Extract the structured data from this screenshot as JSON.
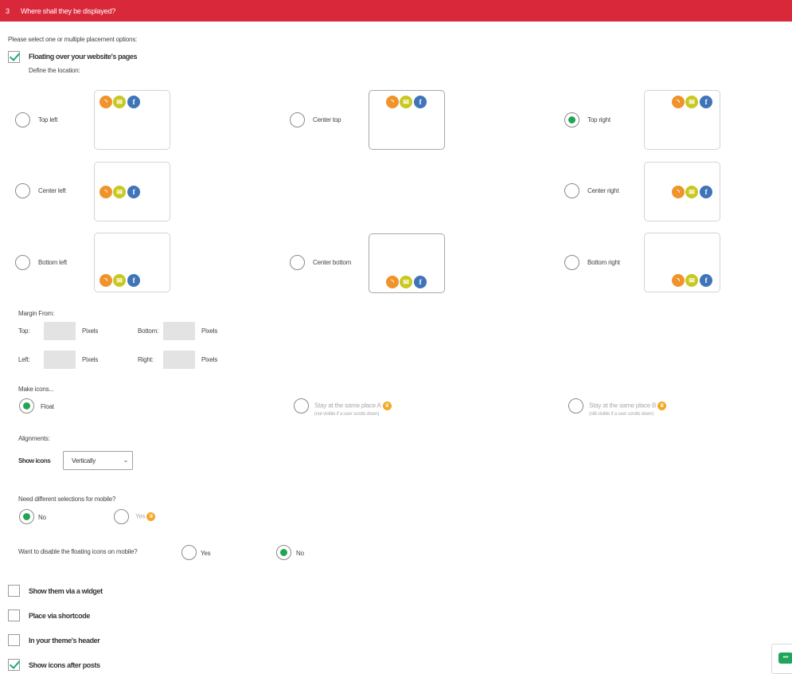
{
  "header": {
    "step": "3",
    "title": "Where shall they be displayed?"
  },
  "intro": "Please select one or multiple placement options:",
  "floating": {
    "label": "Floating over your website's pages",
    "checked": true,
    "define": "Define the location:",
    "locations": [
      {
        "label": "Top left",
        "selected": false
      },
      {
        "label": "Center top",
        "selected": false
      },
      {
        "label": "Top right",
        "selected": true
      },
      {
        "label": "Center left",
        "selected": false
      },
      {
        "label": "Center right",
        "selected": false
      },
      {
        "label": "Bottom left",
        "selected": false
      },
      {
        "label": "Center bottom",
        "selected": false
      },
      {
        "label": "Bottom right",
        "selected": false
      }
    ]
  },
  "icons": {
    "rss": "rss-icon",
    "mail": "email-icon",
    "fb": "facebook-icon",
    "fb_glyph": "f",
    "mail_glyph": "✉",
    "rss_glyph": "⌇"
  },
  "margin": {
    "title": "Margin From:",
    "top": "Top:",
    "bottom": "Bottom:",
    "left": "Left:",
    "right": "Right:",
    "unit": "Pixels"
  },
  "make_icons": {
    "title": "Make icons...",
    "float": "Float",
    "stay_a": "Stay at the same place A",
    "stay_a_note": "(not visible if a user scrolls down)",
    "stay_b": "Stay at the same place B",
    "stay_b_note": "(still visible if a user scrolls down)",
    "selected": "float"
  },
  "alignments": {
    "title": "Alignments:",
    "show_icons": "Show icons",
    "value": "Vertically"
  },
  "mobile": {
    "question": "Need different selections for mobile?",
    "no": "No",
    "yes": "Yes",
    "selected": "no"
  },
  "disable_mobile": {
    "question": "Want to disable the floating icons on mobile?",
    "yes": "Yes",
    "no": "No",
    "selected": "no"
  },
  "options": [
    {
      "label": "Show them via a widget",
      "checked": false
    },
    {
      "label": "Place via shortcode",
      "checked": false
    },
    {
      "label": "In your theme's header",
      "checked": false
    },
    {
      "label": "Show icons after posts",
      "checked": true
    }
  ],
  "colors": {
    "header": "#d9283a",
    "radio_selected": "#23a455",
    "check": "#1fa67a",
    "rss": "#f0932b",
    "mail": "#c9c820",
    "facebook": "#3f74b8",
    "crown": "#f5a623"
  }
}
